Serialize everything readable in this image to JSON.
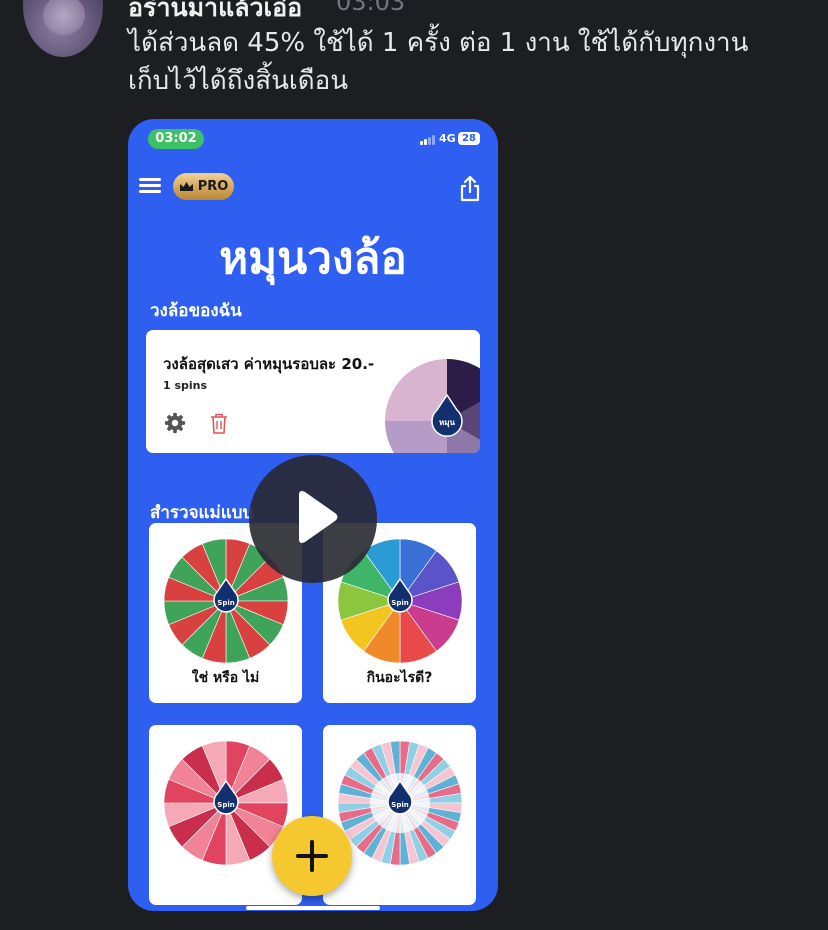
{
  "post": {
    "author": "อร่านมาแล้วเอ๋อ",
    "time": "03:03",
    "message_line1": "ได้ส่วนลด 45% ใช้ได้  1 ครั้ง ต่อ 1 งาน  ใช้ได้กับทุกงาน",
    "message_line2": "เก็บไว้ได้ถึงสิ้นเดือน"
  },
  "phone": {
    "status": {
      "time": "03:02",
      "network": "4G",
      "battery": "28"
    },
    "pro_label": "PRO",
    "app_title": "หมุนวงล้อ",
    "my_wheels_heading": "วงล้อของฉัน",
    "my_wheel": {
      "title": "วงล้อสุดเสว ค่าหมุนรอบละ 20.-",
      "spins": "1 spins",
      "spin_label": "หมุน"
    },
    "explore_heading": "สำรวจแม่แบบ",
    "templates": [
      {
        "label": "ใช่ หรือ ไม่",
        "spin": "Spin"
      },
      {
        "label": "กินอะไรดี?",
        "spin": "Spin"
      },
      {
        "label": "",
        "spin": "Spin"
      },
      {
        "label": "",
        "spin": "Spin"
      }
    ]
  },
  "colors": {
    "app_background": "#2f5ff0",
    "fab": "#f6c830",
    "status_pill": "#3cc264",
    "pro_badge": "#d4a55a",
    "page_background": "#1d1e22"
  },
  "icons": [
    "menu-icon",
    "crown-icon",
    "share-icon",
    "gear-icon",
    "trash-icon",
    "plus-icon",
    "play-icon"
  ]
}
